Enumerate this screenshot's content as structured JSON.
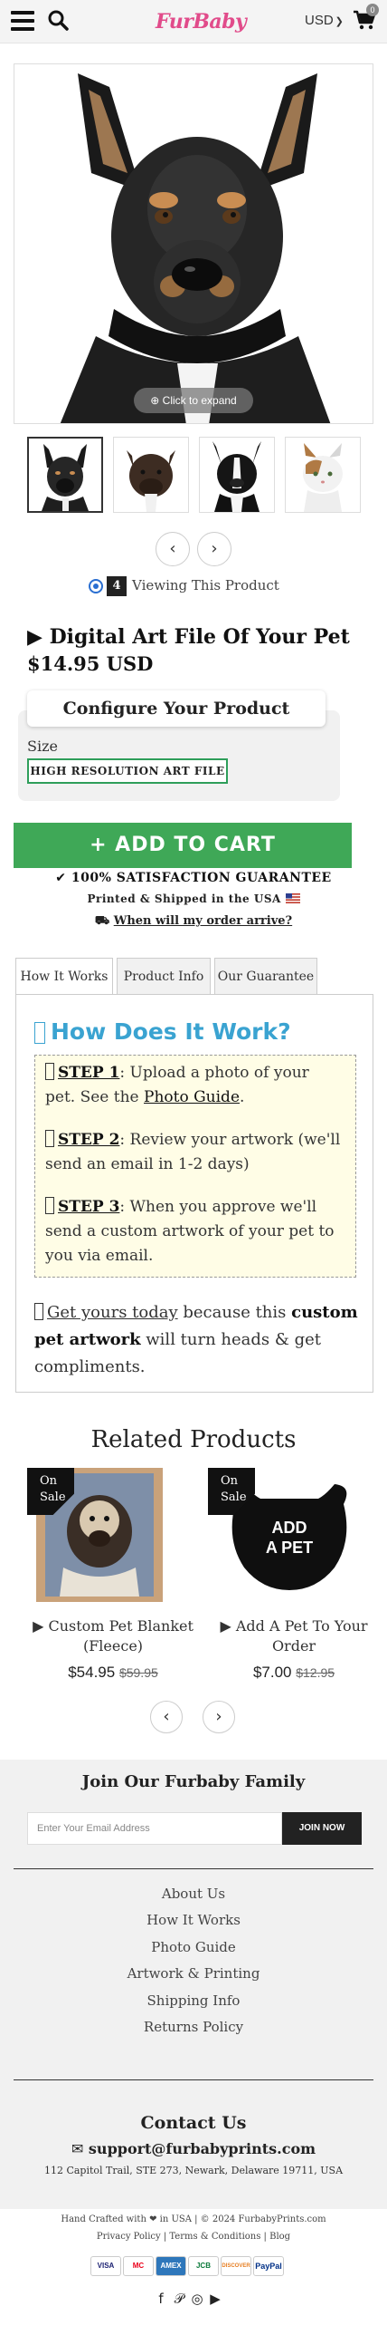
{
  "header": {
    "logo_text": "FurBaby",
    "currency": "USD",
    "cart_count": "0",
    "icons": [
      "hamburger-menu-icon",
      "search-icon",
      "cart-icon",
      "chevron-down-icon"
    ]
  },
  "gallery": {
    "expand_label": "Click to expand",
    "thumbnails": [
      "Shepherd mix dog",
      "Brindle pit bull",
      "Boston terrier",
      "Calico cat"
    ]
  },
  "viewing": {
    "count": "4",
    "label": "Viewing This Product"
  },
  "product": {
    "title": "▶ Digital Art File Of Your Pet",
    "price": "$14.95 USD"
  },
  "configure": {
    "title": "Configure Your Product",
    "size_label": "Size",
    "size_option": "HIGH RESOLUTION ART FILE"
  },
  "cart": {
    "add_label": "+ ADD TO CART",
    "guarantee": "100% SATISFACTION GUARANTEE",
    "printed": "Printed & Shipped in the USA",
    "arrive_link": "When will my order arrive?"
  },
  "tabs": [
    "How It Works",
    "Product Info",
    "Our Guarantee"
  ],
  "how_it_works": {
    "title": "How Does It Work?",
    "step1_label": "STEP 1",
    "step1_text_a": ": Upload a photo of your pet. See the ",
    "step1_link": "Photo Guide",
    "step1_text_b": ".",
    "step2_label": "STEP 2",
    "step2_text": ": Review your artwork (we'll send an email in 1-2 days)",
    "step3_label": "STEP 3",
    "step3_text": ": When you approve we'll send a custom artwork of your pet to you via email.",
    "cta_link": "Get yours today",
    "cta_text_a": " because this ",
    "cta_bold": "custom pet artwork",
    "cta_text_b": " will turn heads & get compliments."
  },
  "related": {
    "title": "Related Products",
    "items": [
      {
        "badge": "On Sale",
        "name": "▶ Custom Pet Blanket (Fleece)",
        "price": "$54.95",
        "old_price": "$59.95"
      },
      {
        "badge": "On Sale",
        "name": "▶ Add A Pet To Your Order",
        "price": "$7.00",
        "old_price": "$12.95",
        "image_text": "ADD A PET"
      }
    ]
  },
  "newsletter": {
    "title": "Join Our Furbaby Family",
    "placeholder": "Enter Your Email Address",
    "button": "JOIN NOW"
  },
  "footer_links": [
    "About Us",
    "How It Works",
    "Photo Guide",
    "Artwork & Printing",
    "Shipping Info",
    "Returns Policy"
  ],
  "contact": {
    "title": "Contact Us",
    "email": "support@furbabyprints.com",
    "address": "112 Capitol Trail, STE 273, Newark, Delaware 19711, USA"
  },
  "bottom": {
    "crafted": "Hand Crafted with ❤ in USA | © 2024 FurbabyPrints.com",
    "legal": "Privacy Policy | Terms & Conditions | Blog",
    "payments": [
      "VISA",
      "MC",
      "AMEX",
      "JCB",
      "DISCOVER",
      "PayPal"
    ]
  },
  "colors": {
    "accent_green": "#3fa857",
    "accent_blue": "#3aa3d1",
    "logo_pink": "#e14b8a"
  }
}
